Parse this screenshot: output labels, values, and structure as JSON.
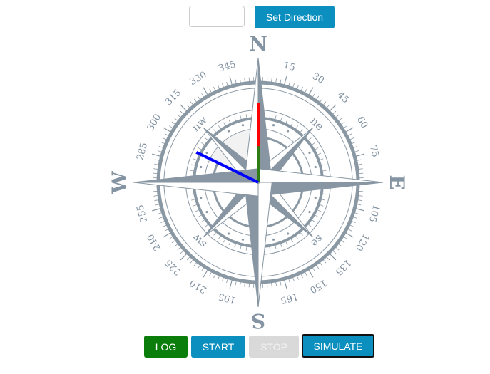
{
  "controls": {
    "direction_input": {
      "value": "",
      "placeholder": ""
    },
    "set_direction_label": "Set Direction"
  },
  "compass": {
    "cardinals": [
      "N",
      "E",
      "S",
      "W"
    ],
    "intercardinals": [
      "ne",
      "se",
      "sw",
      "nw"
    ],
    "degree_labels": [
      "15",
      "30",
      "45",
      "60",
      "75",
      "105",
      "120",
      "135",
      "150",
      "165",
      "195",
      "210",
      "225",
      "240",
      "255",
      "285",
      "300",
      "315",
      "330",
      "345"
    ],
    "needles": [
      {
        "name": "red-needle",
        "color": "#ff0000",
        "heading_deg": 0,
        "length": 0.64
      },
      {
        "name": "green-needle",
        "color": "#2e7d12",
        "heading_deg": 0,
        "length": 0.29
      },
      {
        "name": "blue-needle",
        "color": "#0000ff",
        "heading_deg": 296,
        "length": 0.55
      }
    ],
    "colors": {
      "rose": "#8796a2",
      "ring": "#8a98a4",
      "sector": "#f2f2f2"
    }
  },
  "buttons": {
    "log": "LOG",
    "start": "START",
    "stop": "STOP",
    "simulate": "SIMULATE"
  },
  "button_colors": {
    "log": "#0b7d0b",
    "start": "#0a8fbf",
    "stop": "#d9d9d9",
    "simulate": "#0a8fbf"
  }
}
